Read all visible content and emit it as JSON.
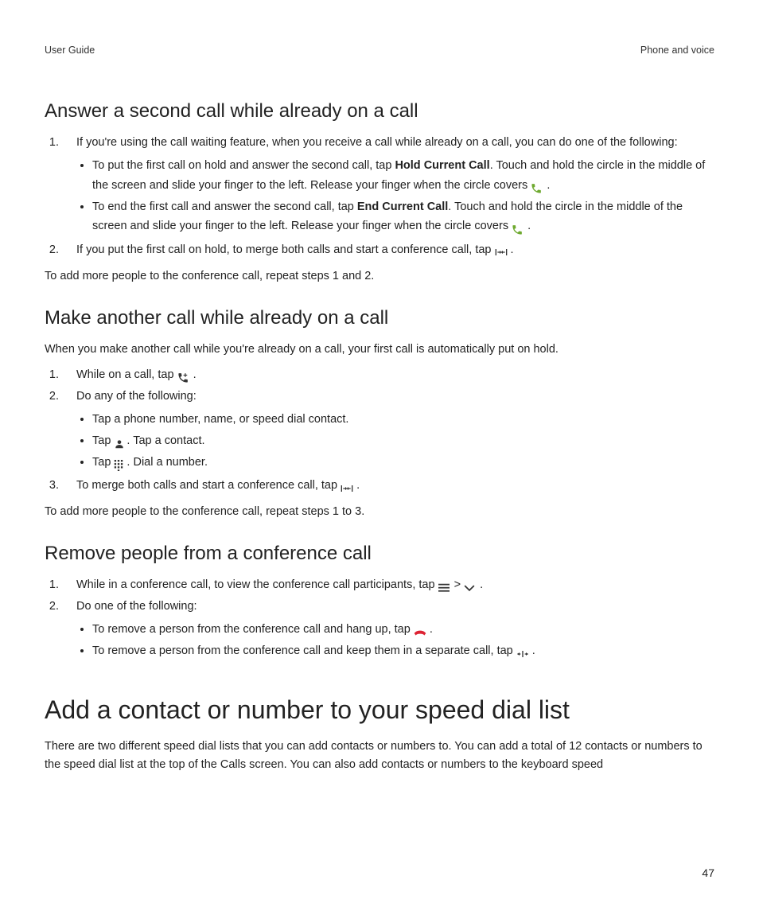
{
  "header": {
    "left": "User Guide",
    "right": "Phone and voice"
  },
  "section1": {
    "title": "Answer a second call while already on a call",
    "step1_intro": "If you're using the call waiting feature, when you receive a call while already on a call, you can do one of the following:",
    "bullet1a_pre": "To put the first call on hold and answer the second call, tap ",
    "bullet1a_bold": "Hold Current Call",
    "bullet1a_post": ". Touch and hold the circle in the middle of the screen and slide your finger to the left. Release your finger when the circle covers ",
    "bullet1b_pre": "To end the first call and answer the second call, tap ",
    "bullet1b_bold": "End Current Call",
    "bullet1b_post": ". Touch and hold the circle in the middle of the screen and slide your finger to the left. Release your finger when the circle covers ",
    "step2": "If you put the first call on hold, to merge both calls and start a conference call, tap ",
    "after": "To add more people to the conference call, repeat steps 1 and 2."
  },
  "section2": {
    "title": "Make another call while already on a call",
    "intro": "When you make another call while you're already on a call, your first call is automatically put on hold.",
    "step1": "While on a call, tap ",
    "step2": "Do any of the following:",
    "bullet2a": "Tap a phone number, name, or speed dial contact.",
    "bullet2b_pre": "Tap ",
    "bullet2b_post": ". Tap a contact.",
    "bullet2c_pre": "Tap ",
    "bullet2c_post": ". Dial a number.",
    "step3": "To merge both calls and start a conference call, tap ",
    "after": "To add more people to the conference call, repeat steps 1 to 3."
  },
  "section3": {
    "title": "Remove people from a conference call",
    "step1": "While in a conference call, to view the conference call participants, tap ",
    "gt": " > ",
    "step2": "Do one of the following:",
    "bullet3a": "To remove a person from the conference call and hang up, tap ",
    "bullet3b": "To remove a person from the conference call and keep them in a separate call, tap "
  },
  "section4": {
    "title": "Add a contact or number to your speed dial list",
    "body": "There are two different speed dial lists that you can add contacts or numbers to. You can add a total of 12 contacts or numbers to the speed dial list at the top of the Calls screen. You can also add contacts or numbers to the keyboard speed"
  },
  "pagenum": "47"
}
